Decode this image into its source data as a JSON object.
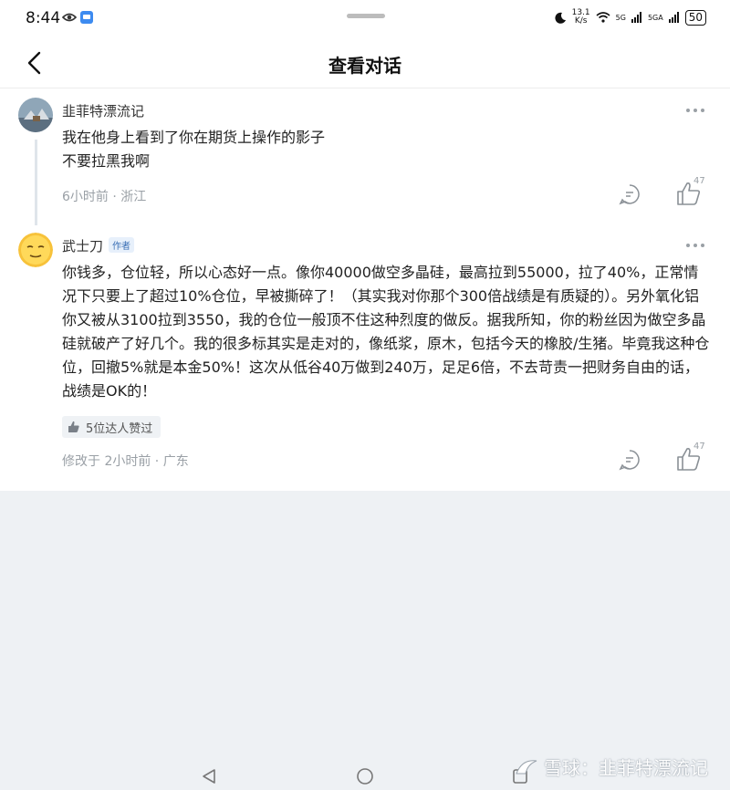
{
  "status_bar": {
    "time": "8:44",
    "net_speed_value": "13.1",
    "net_speed_unit": "K/s",
    "signal1": "5G",
    "signal2": "5GA",
    "battery": "50"
  },
  "nav": {
    "title": "查看对话"
  },
  "comments": [
    {
      "author": "韭菲特漂流记",
      "body_lines": [
        "我在他身上看到了你在期货上操作的影子",
        "不要拉黑我啊"
      ],
      "meta": "6小时前 · 浙江",
      "like_count": "47"
    },
    {
      "author": "武士刀",
      "author_tag": "作者",
      "body": "你钱多，仓位轻，所以心态好一点。像你40000做空多晶硅，最高拉到55000，拉了40%，正常情况下只要上了超过10%仓位，早被撕碎了！（其实我对你那个300倍战绩是有质疑的）。另外氧化铝你又被从3100拉到3550，我的仓位一般顶不住这种烈度的做反。据我所知，你的粉丝因为做空多晶硅就破产了好几个。我的很多标其实是走对的，像纸浆，原木，包括今天的橡胶/生猪。毕竟我这种仓位，回撤5%就是本金50%！这次从低谷40万做到240万，足足6倍，不去苛责一把财务自由的话，战绩是OK的！",
      "likers": "5位达人赞过",
      "meta": "修改于 2小时前 · 广东",
      "like_count": "47"
    }
  ],
  "watermark": "雪球：韭菲特漂流记",
  "colors": {
    "background": "#eef1f4",
    "card": "#ffffff",
    "meta_text": "#9aa0a6",
    "tag_blue": "#3a6fb5"
  }
}
